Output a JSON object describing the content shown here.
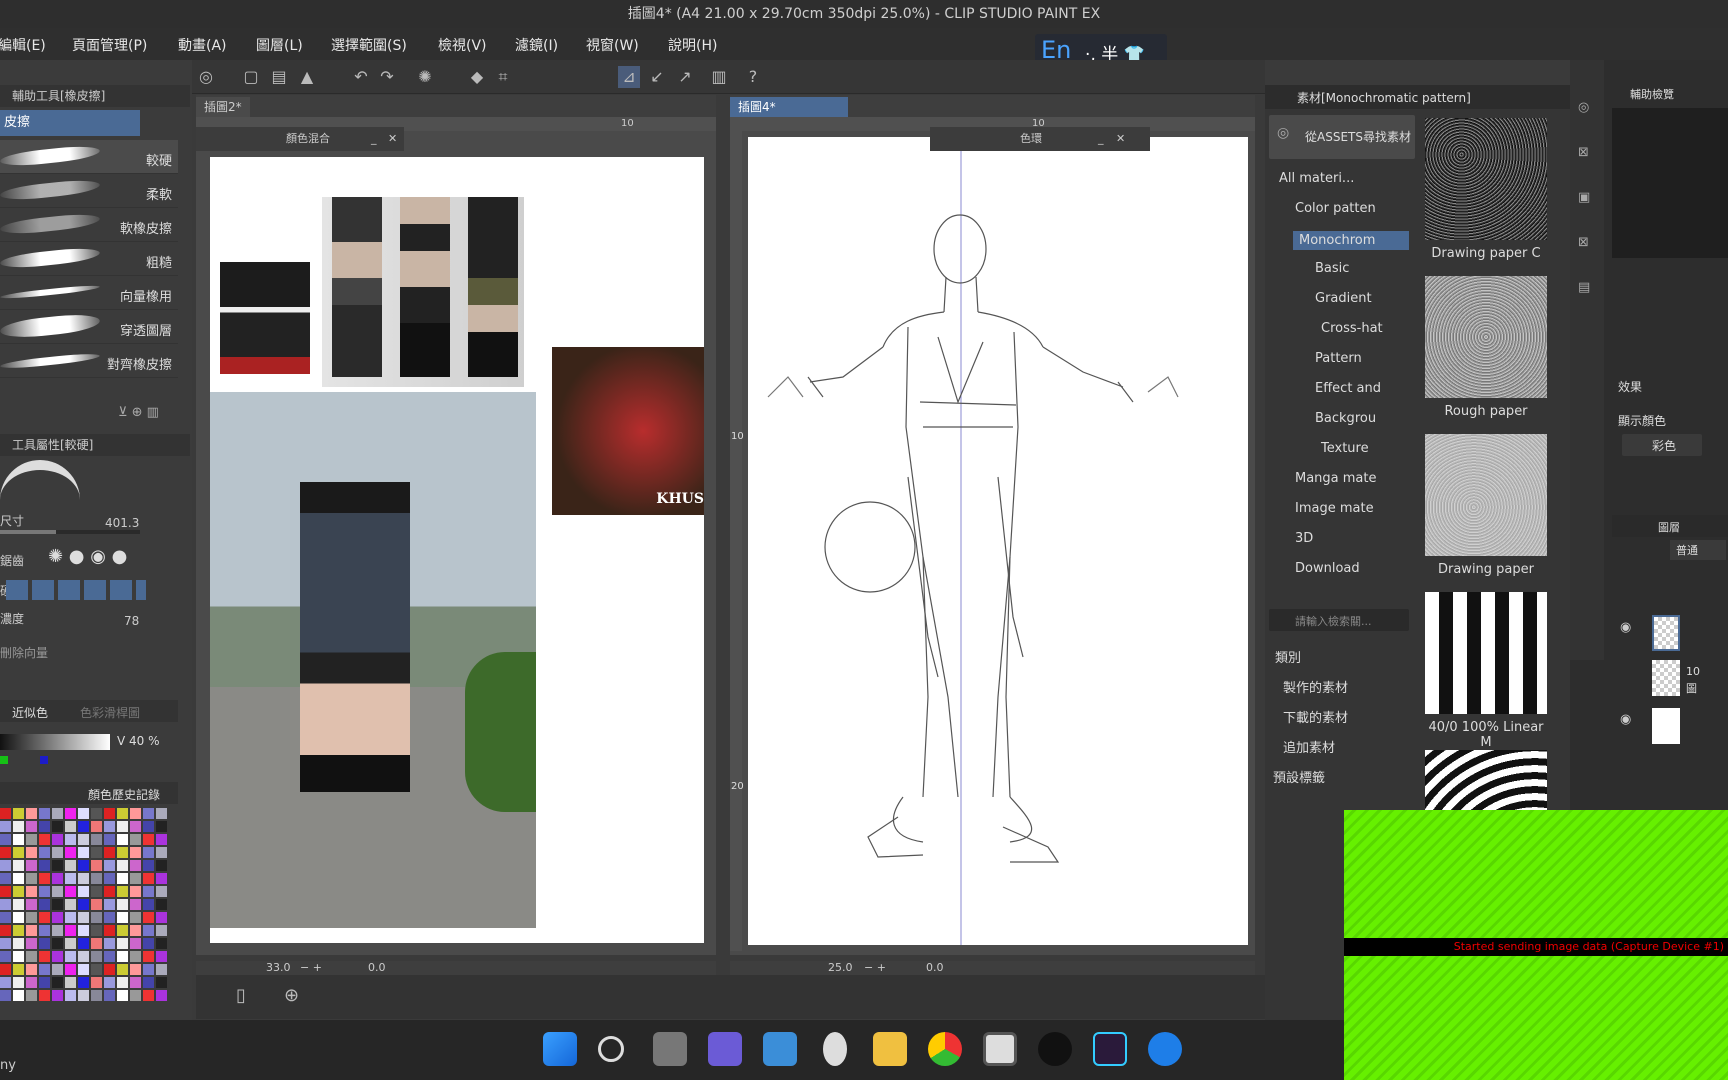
{
  "window": {
    "title": "插圖4* (A4 21.00 x 29.70cm 350dpi 25.0%) - CLIP STUDIO PAINT EX"
  },
  "menu": [
    "編輯(E)",
    "頁面管理(P)",
    "動畫(A)",
    "圖層(L)",
    "選擇範圍(S)",
    "檢視(V)",
    "濾鏡(I)",
    "視窗(W)",
    "說明(H)"
  ],
  "ime": {
    "lang": "En",
    "rest": "·, 半 👕"
  },
  "left": {
    "subtool_header": "輔助工具[橡皮擦]",
    "subtool_group": "皮擦",
    "brushes": [
      "較硬",
      "柔軟",
      "軟橡皮擦",
      "粗糙",
      "向量橡用",
      "穿透圖層",
      "對齊橡皮擦"
    ],
    "prop_header": "工具屬性[較硬]",
    "size_label": "尺寸",
    "size_value": "401.3",
    "aa_label": "鋸齒",
    "hardness_label": "硬",
    "density_label": "濃度",
    "density_value": "78",
    "eraser_dir_label": "刪除向量",
    "color_tab_1": "近似色",
    "color_tab_2": "色彩滑桿圖",
    "value_label": "V 40 %",
    "history_tab": "顏色歷史記錄"
  },
  "canvas1": {
    "tab": "插圖2*",
    "ruler_mark": "10",
    "float_title": "顏色混合",
    "zoom": "33.0",
    "angle": "0.0",
    "photo_text": "KHUS"
  },
  "canvas2": {
    "tab": "插圖4*",
    "ruler_mark": "10",
    "ruler_v1": "10",
    "ruler_v2": "20",
    "float_title": "色環",
    "zoom": "25.0",
    "angle": "0.0"
  },
  "materials": {
    "header": "素材[Monochromatic pattern]",
    "search_button": "從ASSETS尋找素材",
    "tree": [
      "All materi...",
      "Color patten",
      "Monochrom",
      "Basic",
      "Gradient",
      "Cross-hat",
      "Pattern",
      "Effect and",
      "Backgrou",
      "Texture",
      "Manga mate",
      "Image mate",
      "3D",
      "Download"
    ],
    "search_placeholder": "請輸入檢索關...",
    "category_label": "類別",
    "cat_buttons": [
      "製作的素材",
      "下載的素材",
      "追加素材"
    ],
    "preset_label": "預設標籤",
    "thumbs": [
      "Drawing paper C",
      "Rough paper",
      "Drawing paper",
      "40/0 100% Linear M"
    ]
  },
  "right": {
    "nav_label": "輔助檢覽",
    "effect_label": "效果",
    "display_color_label": "顯示顏色",
    "color_mode": "彩色",
    "layer_header": "圖層",
    "blend_mode": "普通",
    "layer_nums": [
      "10",
      "圖"
    ]
  },
  "capture": {
    "message": "Started sending image data (Capture Device #1)"
  },
  "taskbar": {
    "left_text": "ny"
  }
}
